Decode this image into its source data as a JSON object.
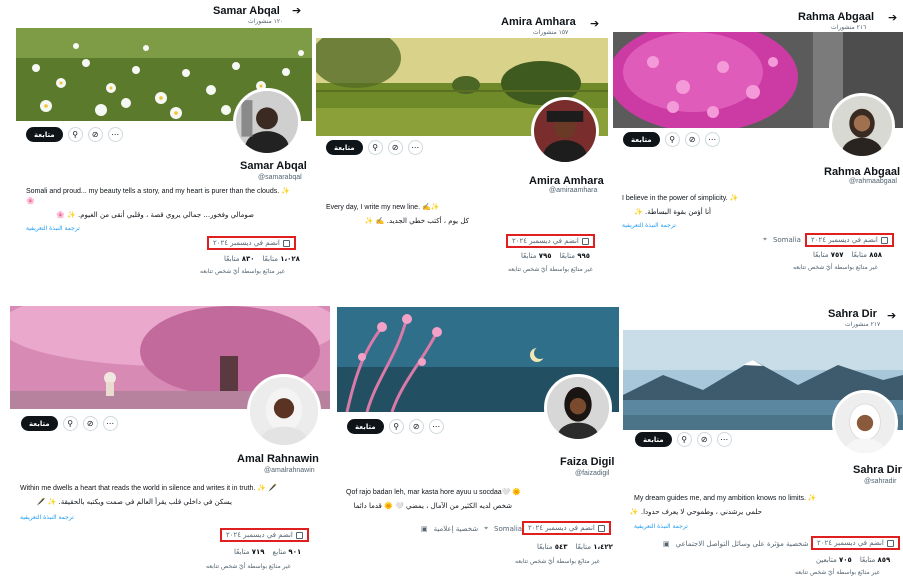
{
  "common": {
    "follow_label": "متابعة",
    "more_icon": "more-icon",
    "search_icon": "search-icon",
    "notification_icon": "notification-icon",
    "translate_label": "ترجمة النبذة التعريفية",
    "joined_label": "انضم في ديسمبر ٢٠٢٤",
    "not_followed_label": "غير متابَع بواسطة أيّ شخص تتابعه",
    "following_word": "متابِعًا",
    "followers_word": "متابعًا"
  },
  "profiles": [
    {
      "top_name": "Samar Abqal",
      "top_count": "١٢٠ منشورات",
      "name": "Samar Abqal",
      "handle": "@samarabqal",
      "bio_en": "Somali and proud... my beauty tells a story, and my heart is purer than the clouds. ✨",
      "bio_en2": "🌸",
      "bio_ar": "صومالي وفخور... جمالي يروي قصة ، وقلبي أنقى من الغيوم. ✨ 🌸",
      "following": "٨٣٠",
      "following_label": "متابعًا",
      "followers": "١،٠٢٨",
      "followers_label": "متابعًا",
      "location": "",
      "category": "",
      "banner_theme": "flowers-white",
      "colors": {
        "sky": "#6b8a3a",
        "ground": "#3f5a22"
      }
    },
    {
      "top_name": "Amira Amhara",
      "top_count": "١٥٧ منشورات",
      "name": "Amira Amhara",
      "handle": "@amiraamhara",
      "bio_en": "Every day, I write my new line. ✍️✨",
      "bio_ar": "كل يوم ، أكتب خطي الجديد. ✍️ ✨",
      "following": "٧٩٥",
      "following_label": "متابعًا",
      "followers": "٩٩٥",
      "followers_label": "متابعًا",
      "location": "",
      "category": "",
      "banner_theme": "meadow",
      "colors": {
        "sky": "#c9c470",
        "ground": "#7c8f2e"
      }
    },
    {
      "top_name": "Rahma Abgaal",
      "top_count": "٢١٦ منشورات",
      "name": "Rahma Abgaal",
      "handle": "@rahmaabgaal",
      "bio_en": "I believe in the power of simplicity. ✨",
      "bio_ar": "أنا أؤمن بقوة البساطة. ✨",
      "following": "٧٥٧",
      "following_label": "متابعًا",
      "followers": "٨٥٨",
      "followers_label": "متابعًا",
      "location": "Somalia",
      "category": "",
      "banner_theme": "petals-pink",
      "colors": {
        "sky": "#c2309b",
        "ground": "#6a6a6a"
      }
    },
    {
      "top_name": "",
      "top_count": "",
      "name": "Amal Rahnawin",
      "handle": "@amalrahnawin",
      "bio_en": "Within me dwells a heart that reads the world in silence and writes it in truth. ✨ 🖋️",
      "bio_ar": "يسكن في داخلي قلب يقرأ العالم في صمت ويكتبه بالحقيقة. ✨ 🖋️",
      "following": "٧١٩",
      "following_label": "متابعًا",
      "followers": "٩٠١",
      "followers_label": "متابع",
      "location": "",
      "category": "",
      "banner_theme": "pink-tree",
      "colors": {
        "sky": "#e9a3c7",
        "ground": "#b76a97"
      }
    },
    {
      "top_name": "",
      "top_count": "",
      "name": "Faiza Digil",
      "handle": "@faizadigil",
      "bio_en": "Qof rajo badan leh, mar kasta hore ayuu u socdaa🤍 🌞",
      "bio_ar": "شخص لديه الكثير من الآمال ، يمضي 🤍 🌞 قدما دائما",
      "following": "٥٤٣",
      "following_label": "متابعًا",
      "followers": "١،٤٢٢",
      "followers_label": "متابعًا",
      "location": "Somalia",
      "category": "شخصية إعلامية",
      "banner_theme": "night-sky",
      "colors": {
        "sky": "#2f6b86",
        "ground": "#1c4d5f"
      }
    },
    {
      "top_name": "Sahra Dir",
      "top_count": "٢١٧ منشورات",
      "name": "Sahra Dir",
      "handle": "@sahradir",
      "bio_en": "My dream guides me, and my ambition knows no limits. ✨",
      "bio_ar": "حلمي يرشدني ، وطموحي لا يعرف حدودا. ✨",
      "following": "٧٠٥",
      "following_label": "متابعين",
      "followers": "٨٥٩",
      "followers_label": "متابعًا",
      "location": "",
      "category": "شخصية مؤثرة على وسائل التواصل الاجتماعي",
      "banner_theme": "mountain-lake",
      "colors": {
        "sky": "#9fc1d8",
        "ground": "#3b5a6e"
      }
    }
  ]
}
